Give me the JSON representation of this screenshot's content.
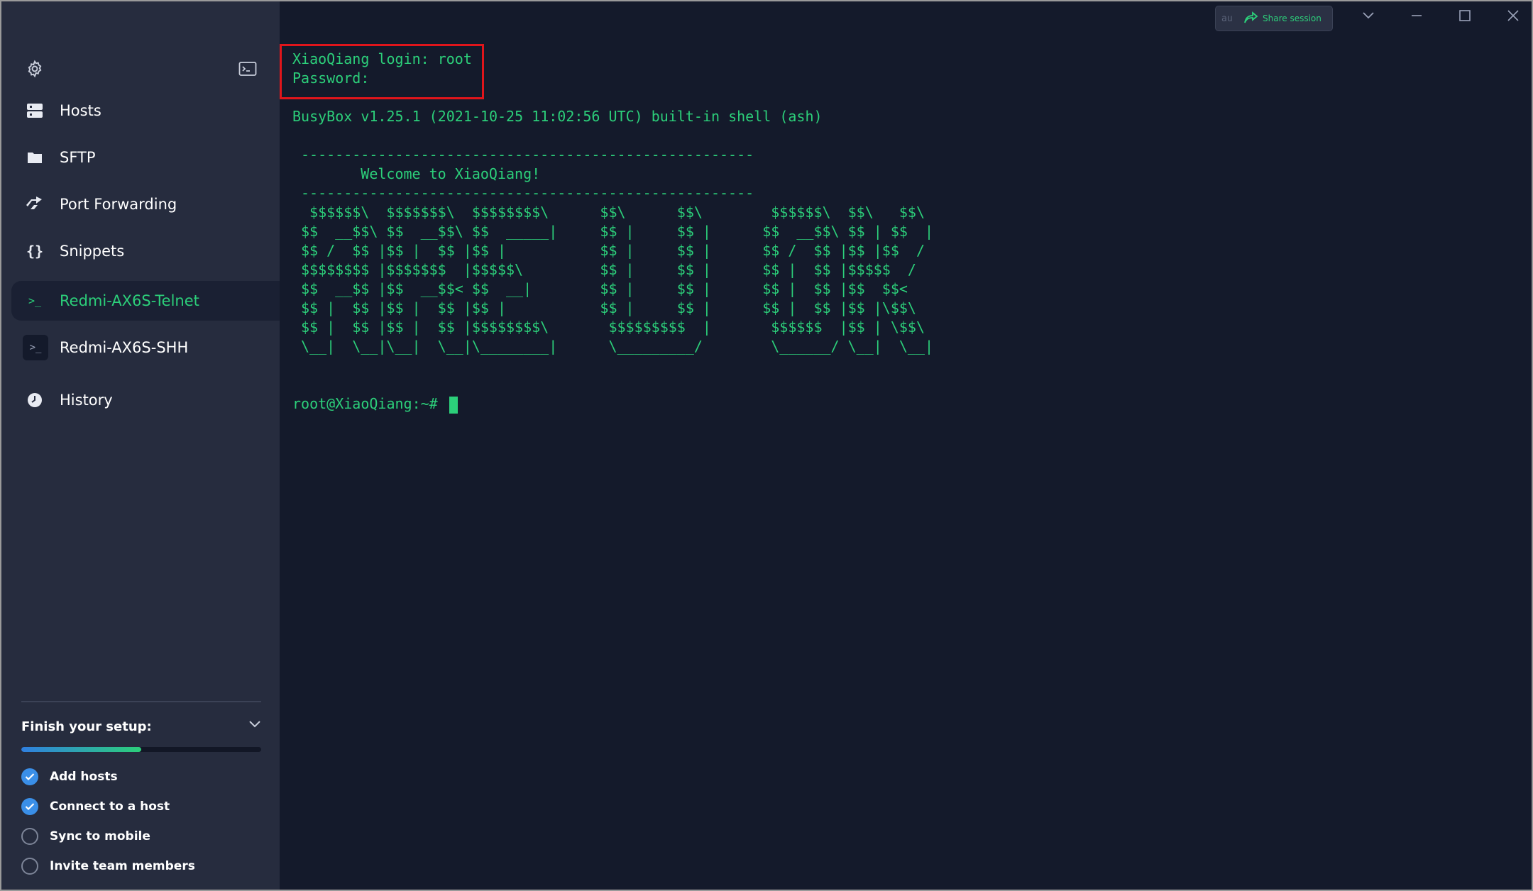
{
  "sidebar": {
    "settings_icon": "gear-icon",
    "terminal_icon": "terminal-icon",
    "nav": [
      {
        "label": "Hosts",
        "icon": "server-icon"
      },
      {
        "label": "SFTP",
        "icon": "folder-icon"
      },
      {
        "label": "Port Forwarding",
        "icon": "forward-icon"
      },
      {
        "label": "Snippets",
        "icon": "braces-icon"
      }
    ],
    "hosts": [
      {
        "label": "Redmi-AX6S-Telnet",
        "icon": "prompt-icon",
        "active": true
      },
      {
        "label": "Redmi-AX6S-SHH",
        "icon": "prompt-icon",
        "active": false
      }
    ],
    "history": {
      "label": "History",
      "icon": "clock-icon"
    },
    "setup": {
      "title": "Finish your setup:",
      "progress_fraction": 0.5,
      "tasks": [
        {
          "label": "Add hosts",
          "done": true
        },
        {
          "label": "Connect to a host",
          "done": true
        },
        {
          "label": "Sync to mobile",
          "done": false
        },
        {
          "label": "Invite team members",
          "done": false
        }
      ]
    }
  },
  "titlebar": {
    "avatar_text": "au",
    "share_label": "Share session"
  },
  "terminal": {
    "lines": [
      "XiaoQiang login: root",
      "Password:",
      "",
      "BusyBox v1.25.1 (2021-10-25 11:02:56 UTC) built-in shell (ash)",
      ""
    ],
    "banner": [
      "-----------------------------------------------------",
      "       Welcome to XiaoQiang!",
      "-----------------------------------------------------",
      " $$$$$$\\  $$$$$$$\\  $$$$$$$$\\      $$\\      $$\\        $$$$$$\\  $$\\   $$\\",
      "$$  __$$\\ $$  __$$\\ $$  _____|     $$ |     $$ |      $$  __$$\\ $$ | $$  |",
      "$$ /  $$ |$$ |  $$ |$$ |           $$ |     $$ |      $$ /  $$ |$$ |$$  /",
      "$$$$$$$$ |$$$$$$$  |$$$$$\\         $$ |     $$ |      $$ |  $$ |$$$$$  /",
      "$$  __$$ |$$  __$$< $$  __|        $$ |     $$ |      $$ |  $$ |$$  $$<",
      "$$ |  $$ |$$ |  $$ |$$ |           $$ |     $$ |      $$ |  $$ |$$ |\\$$\\",
      "$$ |  $$ |$$ |  $$ |$$$$$$$$\\       $$$$$$$$$  |       $$$$$$  |$$ | \\$$\\",
      "\\__|  \\__|\\__|  \\__|\\________|      \\_________/        \\______/ \\__|  \\__|"
    ],
    "prompt": "root@XiaoQiang:~# "
  }
}
